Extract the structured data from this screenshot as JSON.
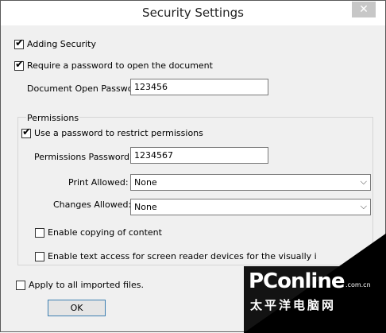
{
  "window": {
    "title": "Security Settings",
    "close_glyph": "✕"
  },
  "adding_security": {
    "label": "Adding Security",
    "checked": true
  },
  "require_password": {
    "label": "Require a password to open the document",
    "checked": true
  },
  "open_password": {
    "label": "Document Open Password:",
    "value": "123456"
  },
  "permissions": {
    "group_label": "Permissions",
    "use_password": {
      "label": "Use a password to restrict permissions",
      "checked": true
    },
    "password": {
      "label": "Permissions Password:",
      "value": "1234567"
    },
    "print_allowed": {
      "label": "Print Allowed:",
      "value": "None"
    },
    "changes_allowed": {
      "label": "Changes Allowed:",
      "value": "None"
    },
    "enable_copying": {
      "label": "Enable copying of content",
      "checked": false
    },
    "enable_text_access": {
      "label": "Enable text access for screen reader devices for the visually i",
      "checked": false
    }
  },
  "apply_all": {
    "label": "Apply to all imported files.",
    "checked": false
  },
  "ok_label": "OK",
  "icons": {
    "checkmark": "✔",
    "dropdown": "⌵"
  },
  "watermark": {
    "logo": "PConline",
    "domain": ".com.cn",
    "chinese": "太平洋电脑网"
  }
}
